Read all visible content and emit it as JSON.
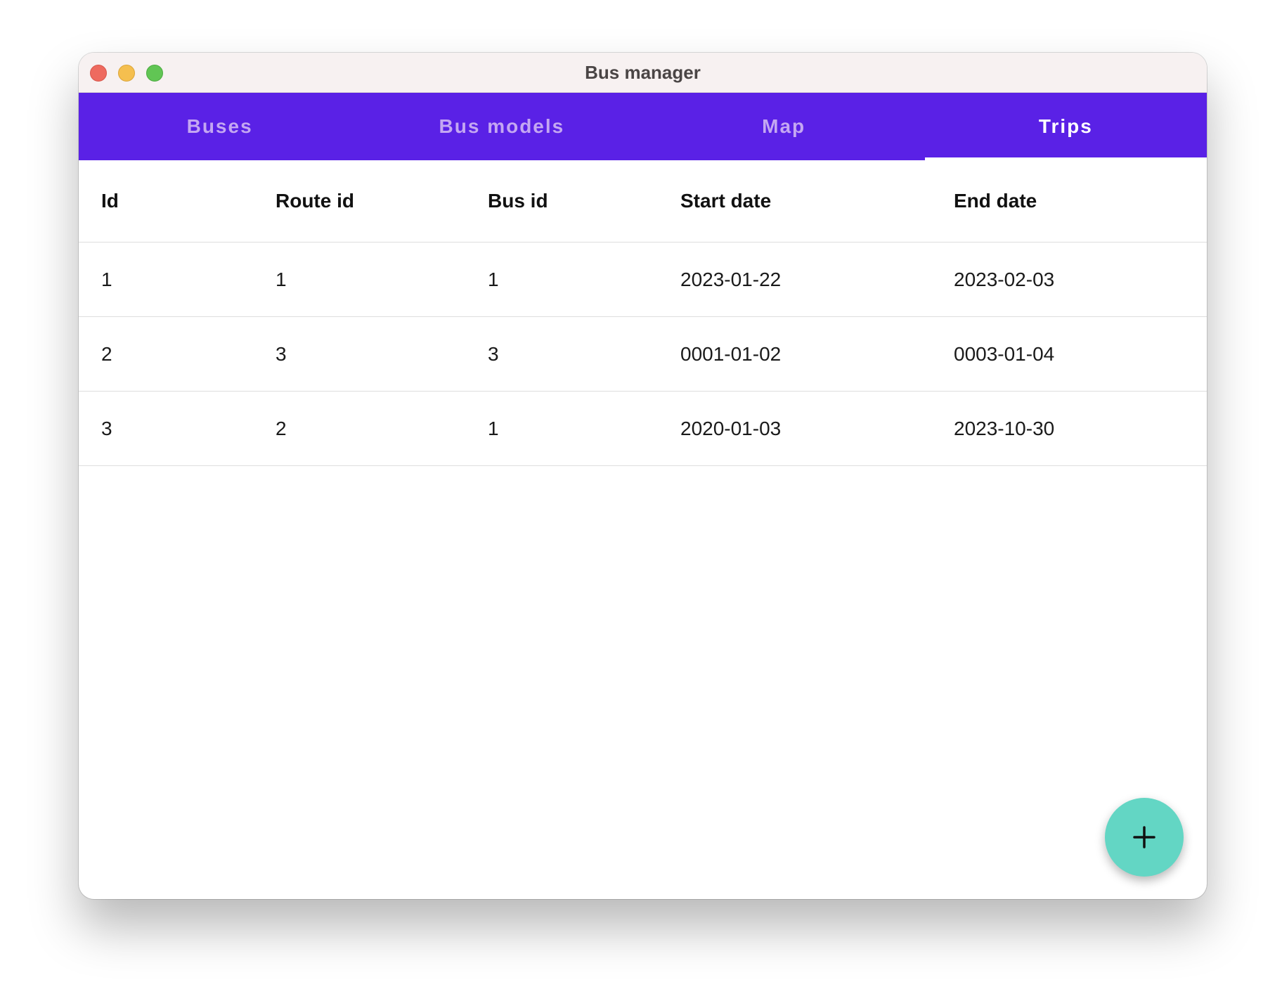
{
  "window": {
    "title": "Bus manager"
  },
  "tabs": [
    {
      "label": "Buses",
      "active": false
    },
    {
      "label": "Bus models",
      "active": false
    },
    {
      "label": "Map",
      "active": false
    },
    {
      "label": "Trips",
      "active": true
    }
  ],
  "table": {
    "columns": [
      "Id",
      "Route id",
      "Bus id",
      "Start date",
      "End date"
    ],
    "rows": [
      [
        "1",
        "1",
        "1",
        "2023-01-22",
        "2023-02-03"
      ],
      [
        "2",
        "3",
        "3",
        "0001-01-02",
        "0003-01-04"
      ],
      [
        "3",
        "2",
        "1",
        "2020-01-03",
        "2023-10-30"
      ]
    ]
  },
  "fab": {
    "icon": "plus-icon"
  },
  "colors": {
    "tabbar": "#5a21e6",
    "tab_inactive_text": "#c4a7f2",
    "tab_active_text": "#ffffff",
    "fab": "#63d6c4"
  }
}
